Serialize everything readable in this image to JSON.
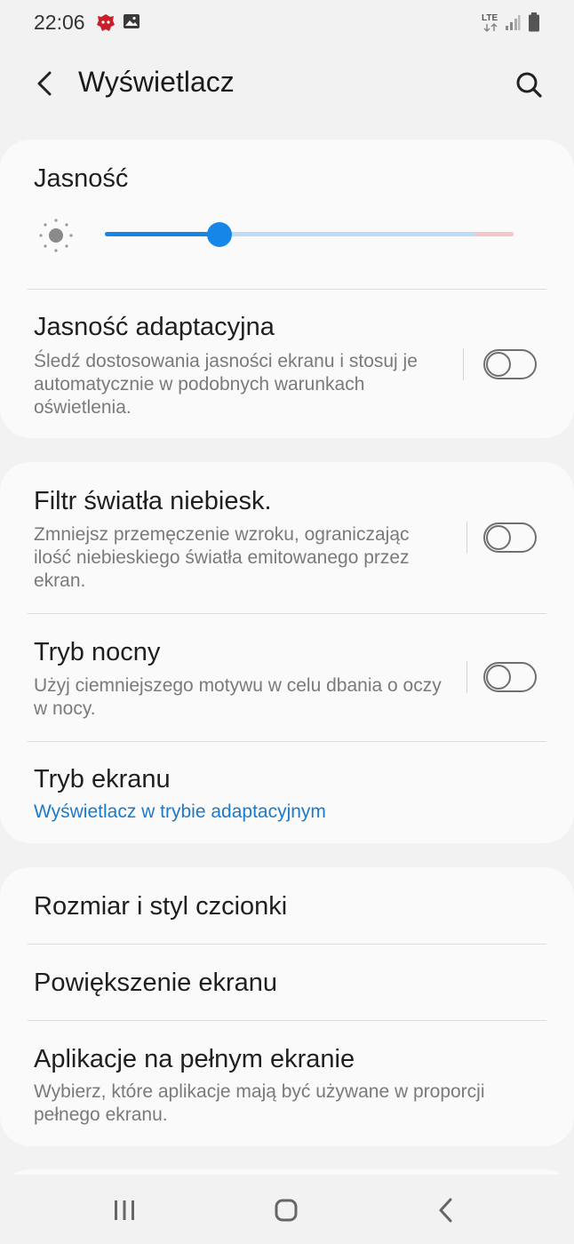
{
  "status_bar": {
    "time": "22:06",
    "network": "LTE",
    "icons": [
      "antutu-icon",
      "image-icon",
      "lte-icon",
      "signal-icon",
      "battery-icon"
    ]
  },
  "header": {
    "title": "Wyświetlacz",
    "back_icon": "back-arrow-icon",
    "search_icon": "search-icon"
  },
  "brightness": {
    "title": "Jasność",
    "icon": "sun-icon",
    "level": 0.28
  },
  "adaptive_brightness": {
    "title": "Jasność adaptacyjna",
    "subtitle": "Śledź dostosowania jasności ekranu i stosuj je automatycznie w podobnych warunkach oświetlenia.",
    "enabled": false
  },
  "blue_light": {
    "title": "Filtr światła niebiesk.",
    "subtitle": "Zmniejsz przemęczenie wzroku, ograniczając ilość niebieskiego światła emitowanego przez ekran.",
    "enabled": false
  },
  "night_mode": {
    "title": "Tryb nocny",
    "subtitle": "Użyj ciemniejszego motywu w celu dbania o oczy w nocy.",
    "enabled": false
  },
  "screen_mode": {
    "title": "Tryb ekranu",
    "value": "Wyświetlacz w trybie adaptacyjnym"
  },
  "font": {
    "title": "Rozmiar i styl czcionki"
  },
  "zoom": {
    "title": "Powiększenie ekranu"
  },
  "fullscreen": {
    "title": "Aplikacje na pełnym ekranie",
    "subtitle": "Wybierz, które aplikacje mają być używane w proporcji pełnego ekranu."
  },
  "nav": {
    "icons": [
      "recents-icon",
      "home-icon",
      "back-icon"
    ]
  },
  "colors": {
    "accent": "#1686e8",
    "link": "#1d7ac9",
    "background": "#f2f2f2",
    "card": "#fafafa"
  }
}
